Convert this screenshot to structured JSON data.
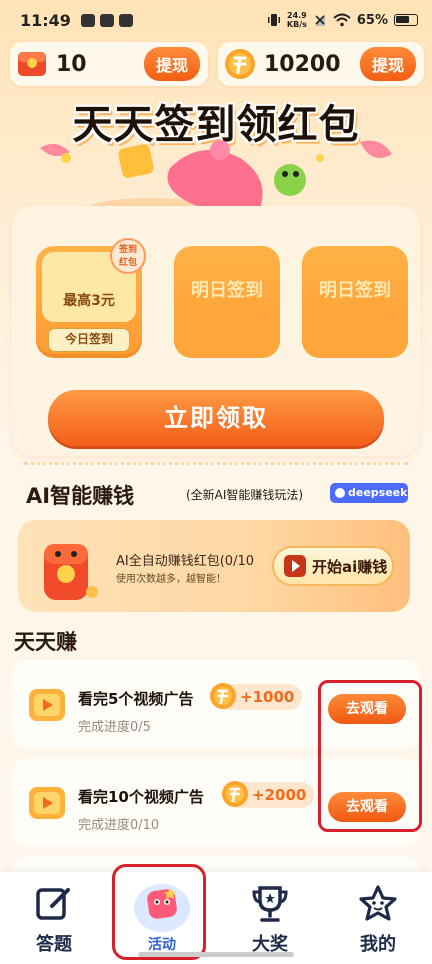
{
  "status": {
    "time": "11:49",
    "speed_top": "24.9",
    "speed_bottom": "KB/s",
    "battery": "65%"
  },
  "balances": {
    "red_packet_amount": "10",
    "coin_amount": "10200",
    "withdraw_label": "提现"
  },
  "hero": {
    "title": "天天签到领红包"
  },
  "checkin": {
    "day1_reward": "最高3元",
    "day1_button": "今日签到",
    "day1_tag_line1": "签到",
    "day1_tag_line2": "红包",
    "day2_label": "明日签到",
    "day3_label": "明日签到",
    "claim_button": "立即领取"
  },
  "ai": {
    "title": "AI智能赚钱",
    "subtitle": "(全新AI智能赚钱玩法)",
    "badge": "deepseek",
    "card_line1": "AI全自动赚钱红包(0/10",
    "card_line2": "使用次数越多，越智能！",
    "button": "开始ai赚钱"
  },
  "daily": {
    "title": "天天赚",
    "tasks": [
      {
        "name": "看完5个视频广告",
        "reward": "+1000",
        "progress": "完成进度0/5",
        "button": "去观看"
      },
      {
        "name": "看完10个视频广告",
        "reward": "+2000",
        "progress": "完成进度0/10",
        "button": "去观看"
      }
    ]
  },
  "nav": {
    "items": [
      {
        "label": "答题",
        "icon": "edit-icon"
      },
      {
        "label": "活动",
        "icon": "activity-icon"
      },
      {
        "label": "大奖",
        "icon": "trophy-icon"
      },
      {
        "label": "我的",
        "icon": "star-face-icon"
      }
    ],
    "active_index": 1
  },
  "colors": {
    "accent": "#f25e18",
    "highlight_box": "#d8202a",
    "nav_active": "#2f60d8"
  }
}
